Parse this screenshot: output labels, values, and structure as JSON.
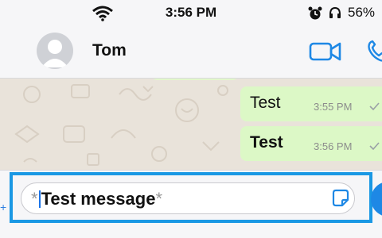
{
  "status_bar": {
    "time": "3:56 PM",
    "battery": "56%"
  },
  "header": {
    "contact_name": "Tom"
  },
  "messages": [
    {
      "text": "Test",
      "time": "3:55 PM",
      "status": "delivered"
    },
    {
      "text": "Test",
      "time": "3:56 PM",
      "status": "delivered"
    }
  ],
  "composer": {
    "marker_open": "*",
    "value": "Test message",
    "marker_close": "*"
  },
  "colors": {
    "accent": "#1a98e4",
    "bubble": "#dcf8c6",
    "wallpaper": "#e9e3da"
  }
}
